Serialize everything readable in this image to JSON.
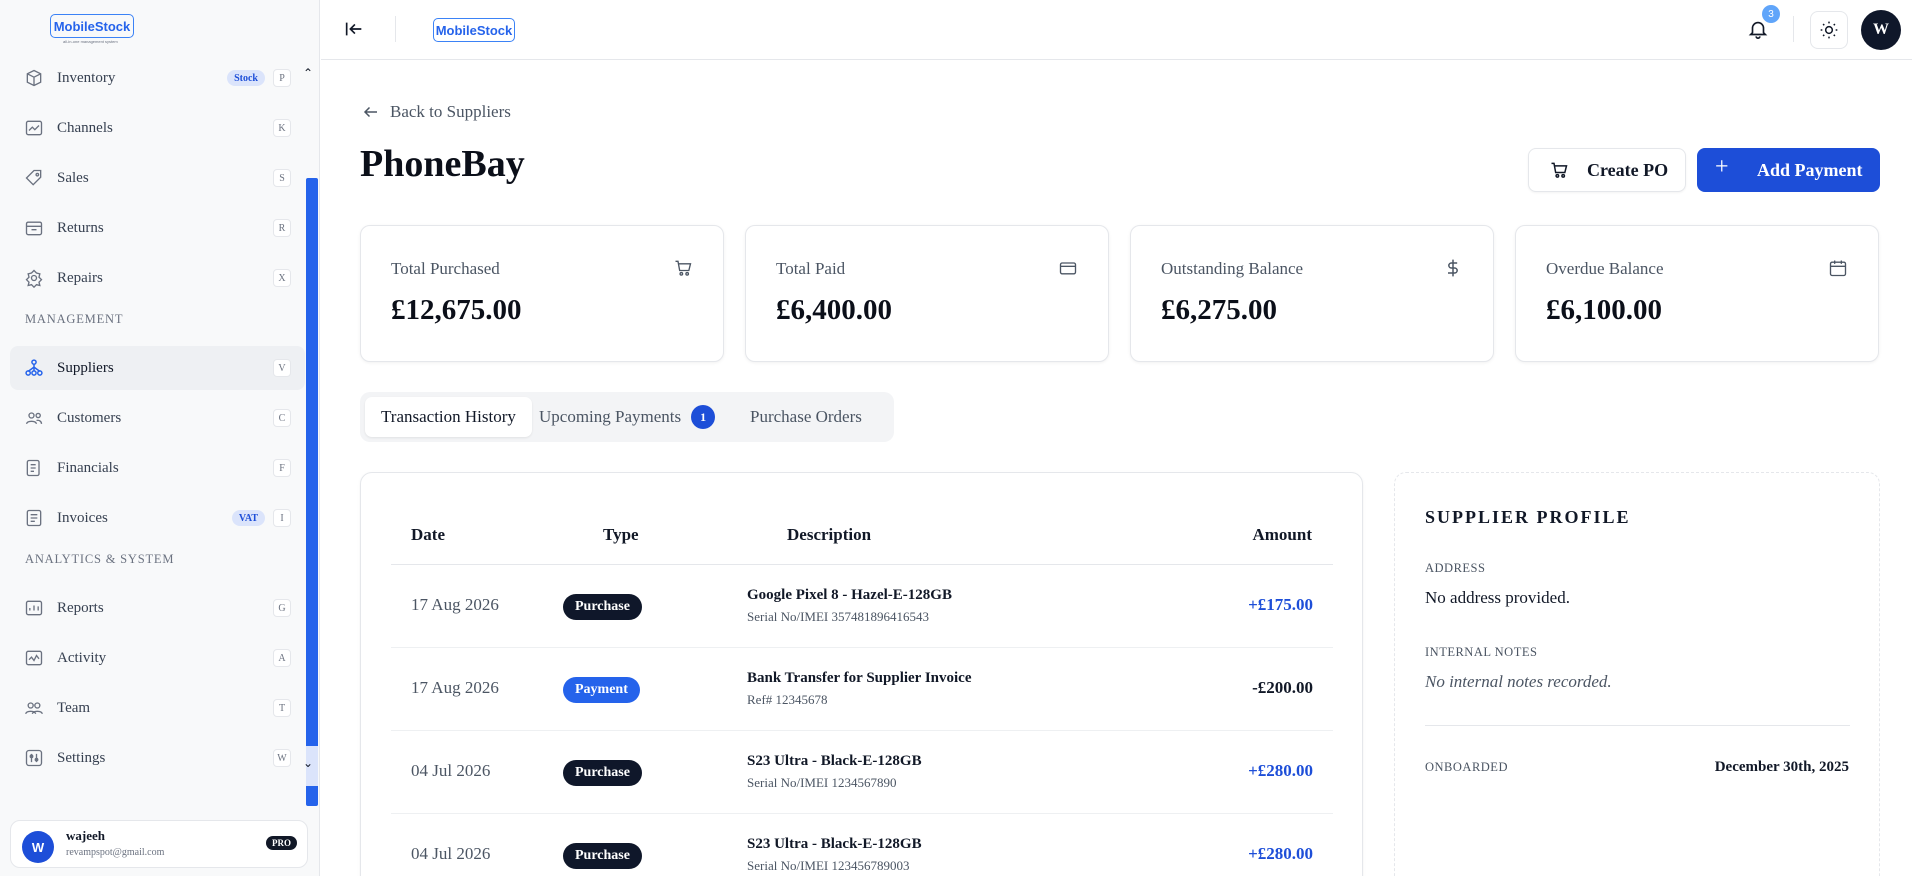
{
  "brand": {
    "logo_text": "MobileStock",
    "logo_tagline": "all-in-one management system"
  },
  "sidebar": {
    "items": [
      {
        "label": "Inventory",
        "badge": "Stock",
        "shortcut": "P",
        "icon": "box-icon"
      },
      {
        "label": "Channels",
        "shortcut": "K",
        "icon": "chart-icon"
      },
      {
        "label": "Sales",
        "shortcut": "S",
        "icon": "tag-icon"
      },
      {
        "label": "Returns",
        "shortcut": "R",
        "icon": "return-icon"
      },
      {
        "label": "Repairs",
        "shortcut": "X",
        "icon": "wrench-icon"
      },
      {
        "label": "Suppliers",
        "shortcut": "V",
        "icon": "network-icon"
      },
      {
        "label": "Customers",
        "shortcut": "C",
        "icon": "users-icon"
      },
      {
        "label": "Financials",
        "shortcut": "F",
        "icon": "ledger-icon"
      },
      {
        "label": "Invoices",
        "badge": "VAT",
        "shortcut": "I",
        "icon": "invoice-icon"
      },
      {
        "label": "Reports",
        "shortcut": "G",
        "icon": "report-icon"
      },
      {
        "label": "Activity",
        "shortcut": "A",
        "icon": "activity-icon"
      },
      {
        "label": "Team",
        "shortcut": "T",
        "icon": "team-icon"
      },
      {
        "label": "Settings",
        "shortcut": "W",
        "icon": "settings-icon"
      }
    ],
    "sections": {
      "management": "MANAGEMENT",
      "analytics": "ANALYTICS & SYSTEM"
    },
    "active": "Suppliers",
    "user": {
      "initial": "W",
      "name": "wajeeh",
      "email": "revampspot@gmail.com",
      "plan": "PRO"
    }
  },
  "topbar": {
    "notification_count": "3",
    "avatar_initial": "W"
  },
  "page": {
    "back_label": "Back to Suppliers",
    "title": "PhoneBay",
    "create_po": "Create PO",
    "add_payment": "Add Payment"
  },
  "stats": [
    {
      "label": "Total Purchased",
      "value": "£12,675.00",
      "icon": "cart-icon"
    },
    {
      "label": "Total Paid",
      "value": "£6,400.00",
      "icon": "card-icon"
    },
    {
      "label": "Outstanding Balance",
      "value": "£6,275.00",
      "icon": "dollar-icon"
    },
    {
      "label": "Overdue Balance",
      "value": "£6,100.00",
      "icon": "calendar-icon"
    }
  ],
  "tabs": [
    {
      "label": "Transaction History",
      "active": true
    },
    {
      "label": "Upcoming Payments",
      "count": "1"
    },
    {
      "label": "Purchase Orders"
    }
  ],
  "transactions": {
    "headers": {
      "date": "Date",
      "type": "Type",
      "description": "Description",
      "amount": "Amount"
    },
    "rows": [
      {
        "date": "17 Aug 2026",
        "type": "Purchase",
        "desc": "Google Pixel 8 - Hazel-E-128GB",
        "sub": "Serial No/IMEI 357481896416543",
        "amount": "+£175.00"
      },
      {
        "date": "17 Aug 2026",
        "type": "Payment",
        "desc": "Bank Transfer for Supplier Invoice",
        "sub": "Ref# 12345678",
        "amount": "-£200.00"
      },
      {
        "date": "04 Jul 2026",
        "type": "Purchase",
        "desc": "S23 Ultra - Black-E-128GB",
        "sub": "Serial No/IMEI 1234567890",
        "amount": "+£280.00"
      },
      {
        "date": "04 Jul 2026",
        "type": "Purchase",
        "desc": "S23 Ultra - Black-E-128GB",
        "sub": "Serial No/IMEI 123456789003",
        "amount": "+£280.00"
      }
    ]
  },
  "profile": {
    "title": "SUPPLIER PROFILE",
    "address_label": "ADDRESS",
    "address_value": "No address provided.",
    "notes_label": "INTERNAL NOTES",
    "notes_value": "No internal notes recorded.",
    "onboarded_label": "ONBOARDED",
    "onboarded_value": "December 30th, 2025"
  }
}
